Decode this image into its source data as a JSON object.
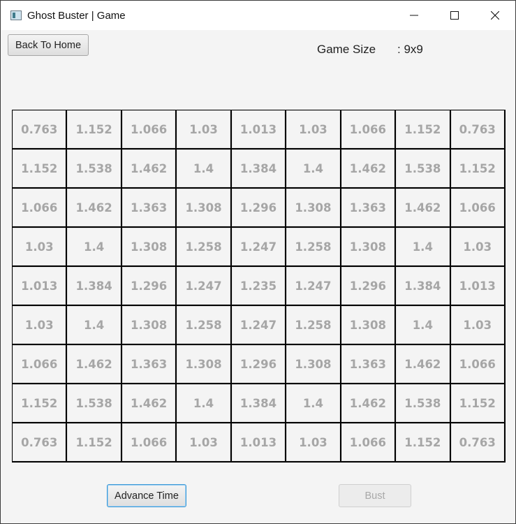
{
  "window": {
    "title": "Ghost Buster | Game",
    "icon": "app-window-icon",
    "controls": [
      "minimize-icon",
      "maximize-icon",
      "close-icon"
    ]
  },
  "toolbar": {
    "back_label": "Back To Home"
  },
  "info": {
    "game_size_label": "Game Size",
    "game_size_value": ": 9x9"
  },
  "board": {
    "rows": [
      [
        "0.763",
        "1.152",
        "1.066",
        "1.03",
        "1.013",
        "1.03",
        "1.066",
        "1.152",
        "0.763"
      ],
      [
        "1.152",
        "1.538",
        "1.462",
        "1.4",
        "1.384",
        "1.4",
        "1.462",
        "1.538",
        "1.152"
      ],
      [
        "1.066",
        "1.462",
        "1.363",
        "1.308",
        "1.296",
        "1.308",
        "1.363",
        "1.462",
        "1.066"
      ],
      [
        "1.03",
        "1.4",
        "1.308",
        "1.258",
        "1.247",
        "1.258",
        "1.308",
        "1.4",
        "1.03"
      ],
      [
        "1.013",
        "1.384",
        "1.296",
        "1.247",
        "1.235",
        "1.247",
        "1.296",
        "1.384",
        "1.013"
      ],
      [
        "1.03",
        "1.4",
        "1.308",
        "1.258",
        "1.247",
        "1.258",
        "1.308",
        "1.4",
        "1.03"
      ],
      [
        "1.066",
        "1.462",
        "1.363",
        "1.308",
        "1.296",
        "1.308",
        "1.363",
        "1.462",
        "1.066"
      ],
      [
        "1.152",
        "1.538",
        "1.462",
        "1.4",
        "1.384",
        "1.4",
        "1.462",
        "1.538",
        "1.152"
      ],
      [
        "0.763",
        "1.152",
        "1.066",
        "1.03",
        "1.013",
        "1.03",
        "1.066",
        "1.152",
        "0.763"
      ]
    ]
  },
  "actions": {
    "advance_label": "Advance Time",
    "bust_label": "Bust",
    "bust_enabled": false
  },
  "colors": {
    "cell_text": "#a6a6a6",
    "focus_border": "#3b98d6"
  }
}
